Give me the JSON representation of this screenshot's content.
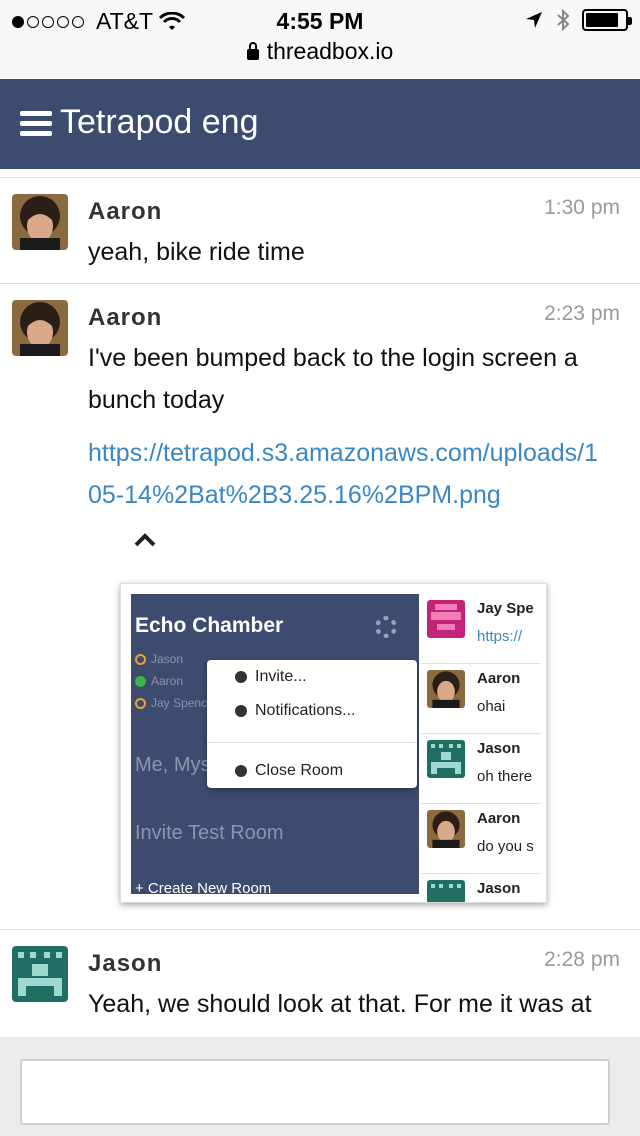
{
  "status_bar": {
    "carrier": "AT&T",
    "time": "4:55 PM",
    "signal_bars_filled": 1,
    "signal_bars_total": 5,
    "battery_level": 0.85,
    "url": "threadbox.io"
  },
  "header": {
    "title": "Tetrapod eng",
    "bg_color": "#3d4b6e"
  },
  "messages": [
    {
      "author": "Aaron",
      "time": "1:30 pm",
      "text": "yeah, bike ride time",
      "avatar_icon": "aaron-photo-avatar"
    },
    {
      "author": "Aaron",
      "time": "2:23 pm",
      "text": "I've been bumped back to the login screen a bunch today",
      "link_line1": "https://tetrapod.s3.amazonaws.com/uploads/1",
      "link_line2": "05-14%2Bat%2B3.25.16%2BPM.png",
      "avatar_icon": "aaron-photo-avatar",
      "attachment": {
        "room_title": "Echo Chamber",
        "members": [
          "Jason",
          "Aaron",
          "Jay Spence"
        ],
        "members_online": [
          false,
          true,
          false
        ],
        "menu_items": [
          "Invite...",
          "Notifications...",
          "Close Room"
        ],
        "rooms": [
          "Me, Myself, & I",
          "Invite Test Room"
        ],
        "new_room": "+ Create New Room",
        "chat_rows": [
          {
            "name": "Jay Spe",
            "text": "https://",
            "is_link": true,
            "avatar": "pink-pixel-avatar"
          },
          {
            "name": "Aaron",
            "text": "ohai",
            "is_link": false,
            "avatar": "aaron-photo-avatar"
          },
          {
            "name": "Jason",
            "text": "oh there",
            "is_link": false,
            "avatar": "teal-pixel-avatar"
          },
          {
            "name": "Aaron",
            "text": "do you s",
            "is_link": false,
            "avatar": "aaron-photo-avatar"
          },
          {
            "name": "Jason",
            "text": "",
            "is_link": false,
            "avatar": "teal-pixel-avatar"
          }
        ]
      }
    },
    {
      "author": "Jason",
      "time": "2:28 pm",
      "text": "Yeah, we should look at that. For me it was at",
      "avatar_icon": "teal-pixel-avatar"
    }
  ],
  "compose": {
    "placeholder": "",
    "value": ""
  },
  "colors": {
    "link": "#3a87c5",
    "timestamp": "#9a9a9a",
    "teal_avatar": "#1f6d63"
  }
}
